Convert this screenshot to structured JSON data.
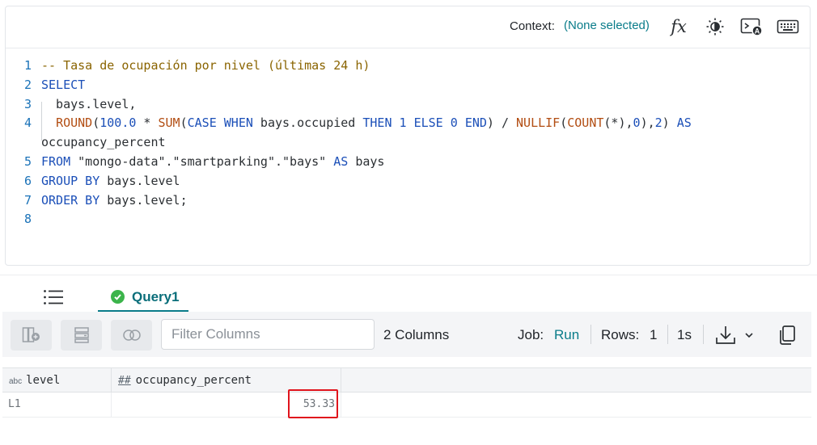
{
  "editor": {
    "context_label": "Context:",
    "context_value": "(None selected)",
    "toolbar_icons": [
      "function-icon",
      "theme-icon",
      "ai-terminal-icon",
      "keyboard-icon"
    ],
    "lines": [
      {
        "n": "1",
        "tokens": [
          {
            "t": "cm",
            "v": "-- Tasa de ocupación por nivel (últimas 24 h)"
          }
        ]
      },
      {
        "n": "2",
        "tokens": [
          {
            "t": "kw",
            "v": "SELECT"
          }
        ]
      },
      {
        "n": "3",
        "tokens": [
          {
            "t": "tx",
            "v": "  bays.level,"
          }
        ]
      },
      {
        "n": "4",
        "tokens": [
          {
            "t": "tx",
            "v": "  "
          },
          {
            "t": "fn",
            "v": "ROUND"
          },
          {
            "t": "tx",
            "v": "("
          },
          {
            "t": "nm",
            "v": "100.0"
          },
          {
            "t": "tx",
            "v": " * "
          },
          {
            "t": "fn",
            "v": "SUM"
          },
          {
            "t": "tx",
            "v": "("
          },
          {
            "t": "kw",
            "v": "CASE WHEN"
          },
          {
            "t": "tx",
            "v": " bays.occupied "
          },
          {
            "t": "kw",
            "v": "THEN"
          },
          {
            "t": "tx",
            "v": " "
          },
          {
            "t": "nm",
            "v": "1"
          },
          {
            "t": "tx",
            "v": " "
          },
          {
            "t": "kw",
            "v": "ELSE"
          },
          {
            "t": "tx",
            "v": " "
          },
          {
            "t": "nm",
            "v": "0"
          },
          {
            "t": "tx",
            "v": " "
          },
          {
            "t": "kw",
            "v": "END"
          },
          {
            "t": "tx",
            "v": ") / "
          },
          {
            "t": "fn",
            "v": "NULLIF"
          },
          {
            "t": "tx",
            "v": "("
          },
          {
            "t": "fn",
            "v": "COUNT"
          },
          {
            "t": "tx",
            "v": "(*),"
          },
          {
            "t": "nm",
            "v": "0"
          },
          {
            "t": "tx",
            "v": "),"
          },
          {
            "t": "nm",
            "v": "2"
          },
          {
            "t": "tx",
            "v": ") "
          },
          {
            "t": "kw",
            "v": "AS"
          }
        ]
      },
      {
        "n": "",
        "tokens": [
          {
            "t": "tx",
            "v": "occupancy_percent"
          }
        ]
      },
      {
        "n": "5",
        "tokens": [
          {
            "t": "kw",
            "v": "FROM"
          },
          {
            "t": "tx",
            "v": " \"mongo-data\".\"smartparking\".\"bays\" "
          },
          {
            "t": "kw",
            "v": "AS"
          },
          {
            "t": "tx",
            "v": " bays"
          }
        ]
      },
      {
        "n": "6",
        "tokens": [
          {
            "t": "kw",
            "v": "GROUP BY"
          },
          {
            "t": "tx",
            "v": " bays.level"
          }
        ]
      },
      {
        "n": "7",
        "tokens": [
          {
            "t": "kw",
            "v": "ORDER BY"
          },
          {
            "t": "tx",
            "v": " bays.level;"
          }
        ]
      },
      {
        "n": "8",
        "tokens": []
      }
    ]
  },
  "tabs": {
    "query_tab_label": "Query1",
    "query_tab_status": "success"
  },
  "results_toolbar": {
    "filter_placeholder": "Filter Columns",
    "filter_value": "",
    "columns_count": "2 Columns",
    "job_label": "Job:",
    "job_action": "Run",
    "rows_label": "Rows:",
    "rows_value": "1",
    "time_value": "1s"
  },
  "grid": {
    "columns": [
      {
        "type_badge": "abc",
        "name": "level"
      },
      {
        "type_badge": "##",
        "name": "occupancy_percent"
      }
    ],
    "rows": [
      [
        "L1",
        "53.33"
      ]
    ]
  },
  "colors": {
    "accent": "#0a7c8a",
    "keyword": "#1b4fb8",
    "function": "#b24d12",
    "comment": "#8a6400",
    "highlight_border": "#e0141c",
    "success": "#3cb44b"
  }
}
